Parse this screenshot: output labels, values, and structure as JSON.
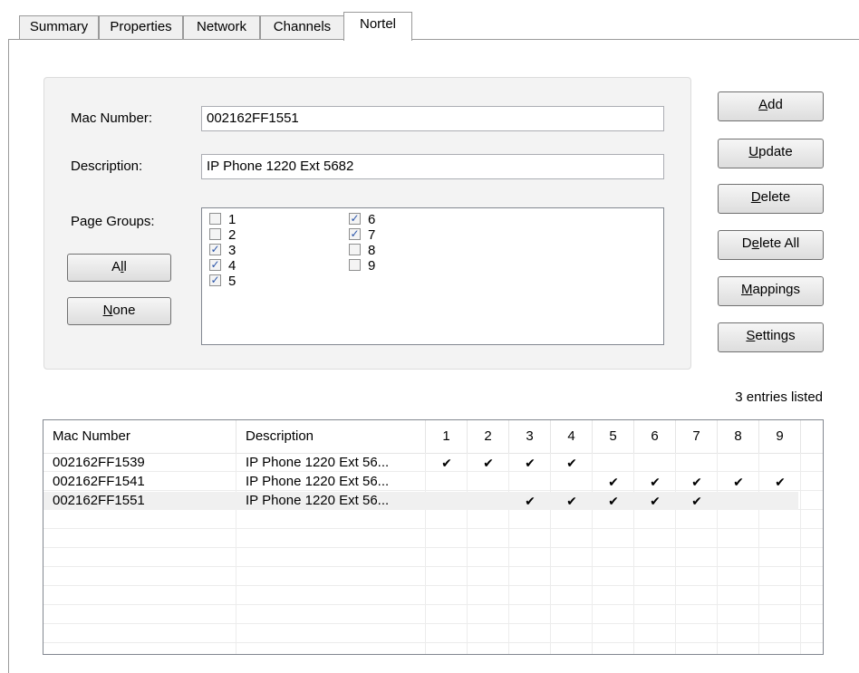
{
  "tabs": [
    "Summary",
    "Properties",
    "Network",
    "Channels",
    "Nortel"
  ],
  "active_tab": "Nortel",
  "form": {
    "mac_label": "Mac Number:",
    "mac_value": "002162FF1551",
    "desc_label": "Description:",
    "desc_value": "IP Phone 1220 Ext 5682",
    "pg_label": "Page Groups:",
    "all_button": {
      "pre": "A",
      "u": "l",
      "post": "l"
    },
    "none_button": {
      "pre": "",
      "u": "N",
      "post": "one"
    }
  },
  "page_groups": [
    {
      "label": "1",
      "checked": false
    },
    {
      "label": "2",
      "checked": false
    },
    {
      "label": "3",
      "checked": true
    },
    {
      "label": "4",
      "checked": true
    },
    {
      "label": "5",
      "checked": true
    },
    {
      "label": "6",
      "checked": true
    },
    {
      "label": "7",
      "checked": true
    },
    {
      "label": "8",
      "checked": false
    },
    {
      "label": "9",
      "checked": false
    }
  ],
  "buttons": {
    "add": {
      "pre": "",
      "u": "A",
      "post": "dd"
    },
    "update": {
      "pre": "",
      "u": "U",
      "post": "pdate"
    },
    "delete": {
      "pre": "",
      "u": "D",
      "post": "elete"
    },
    "delete_all": {
      "pre": "D",
      "u": "e",
      "post": "lete All"
    },
    "mappings": {
      "pre": "",
      "u": "M",
      "post": "appings"
    },
    "settings": {
      "pre": "",
      "u": "S",
      "post": "ettings"
    }
  },
  "status_text": "3 entries listed",
  "list": {
    "columns": [
      "Mac Number",
      "Description",
      "1",
      "2",
      "3",
      "4",
      "5",
      "6",
      "7",
      "8",
      "9"
    ],
    "rows": [
      {
        "mac": "002162FF1539",
        "desc": "IP Phone 1220 Ext 56...",
        "groups": [
          1,
          2,
          3,
          4
        ],
        "selected": false
      },
      {
        "mac": "002162FF1541",
        "desc": "IP Phone 1220 Ext 56...",
        "groups": [
          5,
          6,
          7,
          8,
          9
        ],
        "selected": false
      },
      {
        "mac": "002162FF1551",
        "desc": "IP Phone 1220 Ext 56...",
        "groups": [
          3,
          4,
          5,
          6,
          7
        ],
        "selected": true
      }
    ],
    "check_glyph": "✔"
  }
}
